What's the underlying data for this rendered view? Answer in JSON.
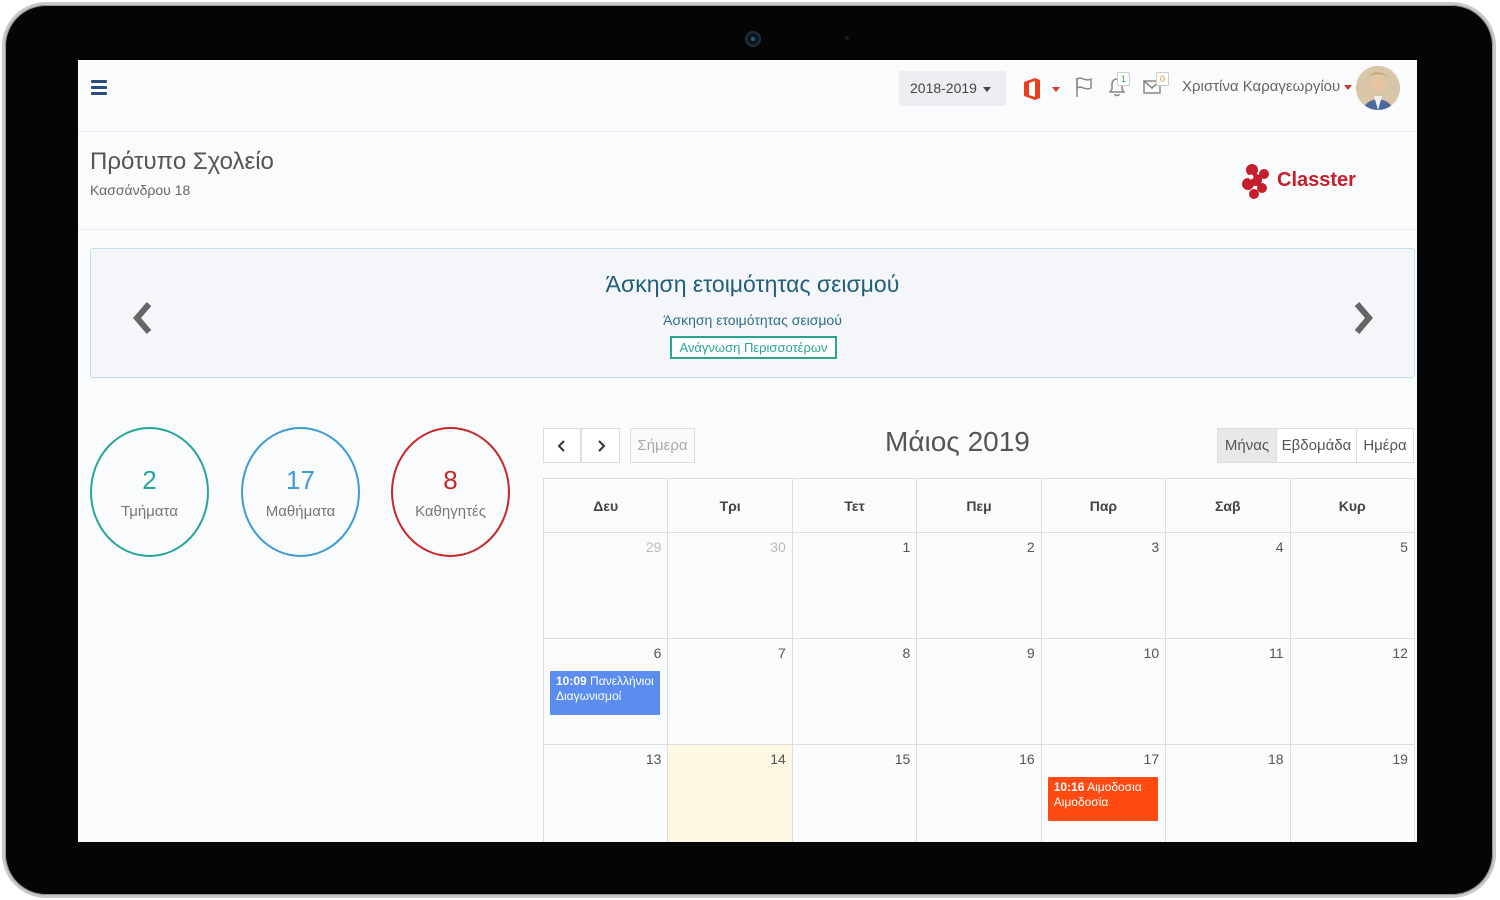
{
  "header": {
    "year": "2018-2019",
    "bell_count": "1",
    "mail_count": "0",
    "user_name": "Χριστίνα Καραγεωργίου"
  },
  "school": {
    "name": "Πρότυπο Σχολείο",
    "address": "Κασσάνδρου 18",
    "brand": "Classter"
  },
  "announcement": {
    "title": "Άσκηση ετοιμότητας σεισμού",
    "text": "Άσκηση ετοιμότητας σεισμού",
    "button": "Ανάγνωση Περισσοτέρων"
  },
  "stats": [
    {
      "value": "2",
      "label": "Τμήματα",
      "color": "#26a69a"
    },
    {
      "value": "17",
      "label": "Μαθήματα",
      "color": "#3d9bd6"
    },
    {
      "value": "8",
      "label": "Καθηγητές",
      "color": "#c62828"
    }
  ],
  "calendar": {
    "title": "Μάιος 2019",
    "today_label": "Σήμερα",
    "views": [
      "Μήνας",
      "Εβδομάδα",
      "Ημέρα"
    ],
    "weekdays": [
      "Δευ",
      "Τρι",
      "Τετ",
      "Πεμ",
      "Παρ",
      "Σαβ",
      "Κυρ"
    ],
    "weeks": [
      [
        "29",
        "30",
        "1",
        "2",
        "3",
        "4",
        "5"
      ],
      [
        "6",
        "7",
        "8",
        "9",
        "10",
        "11",
        "12"
      ],
      [
        "13",
        "14",
        "15",
        "16",
        "17",
        "18",
        "19"
      ]
    ],
    "events": [
      {
        "time": "10:09",
        "title": "Πανελλήνιοι Διαγωνισμοί",
        "color": "#5b8def"
      },
      {
        "time": "10:16",
        "title": "Αιμοδοσια Αιμοδοσία",
        "color": "#ff4a12"
      }
    ]
  }
}
